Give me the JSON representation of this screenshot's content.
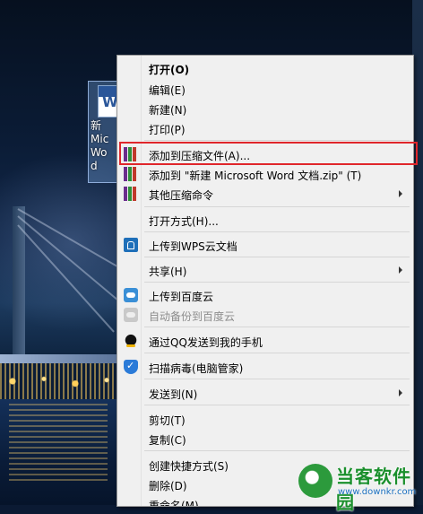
{
  "desktop_icon": {
    "label": "新\nMic\nWo\nd"
  },
  "menu": {
    "items": [
      {
        "label": "打开(O)"
      },
      {
        "label": "编辑(E)"
      },
      {
        "label": "新建(N)"
      },
      {
        "label": "打印(P)"
      },
      {
        "label": "添加到压缩文件(A)..."
      },
      {
        "label": "添加到 \"新建 Microsoft Word 文档.zip\" (T)"
      },
      {
        "label": "其他压缩命令"
      },
      {
        "label": "打开方式(H)..."
      },
      {
        "label": "上传到WPS云文档"
      },
      {
        "label": "共享(H)"
      },
      {
        "label": "上传到百度云"
      },
      {
        "label": "自动备份到百度云"
      },
      {
        "label": "通过QQ发送到我的手机"
      },
      {
        "label": "扫描病毒(电脑管家)"
      },
      {
        "label": "发送到(N)"
      },
      {
        "label": "剪切(T)"
      },
      {
        "label": "复制(C)"
      },
      {
        "label": "创建快捷方式(S)"
      },
      {
        "label": "删除(D)"
      },
      {
        "label": "重命名(M)"
      }
    ]
  },
  "watermark": {
    "title": "当客软件园",
    "url": "www.downkr.com"
  },
  "colors": {
    "highlight": "#e0262b",
    "menu_bg": "#f0f0f0"
  }
}
